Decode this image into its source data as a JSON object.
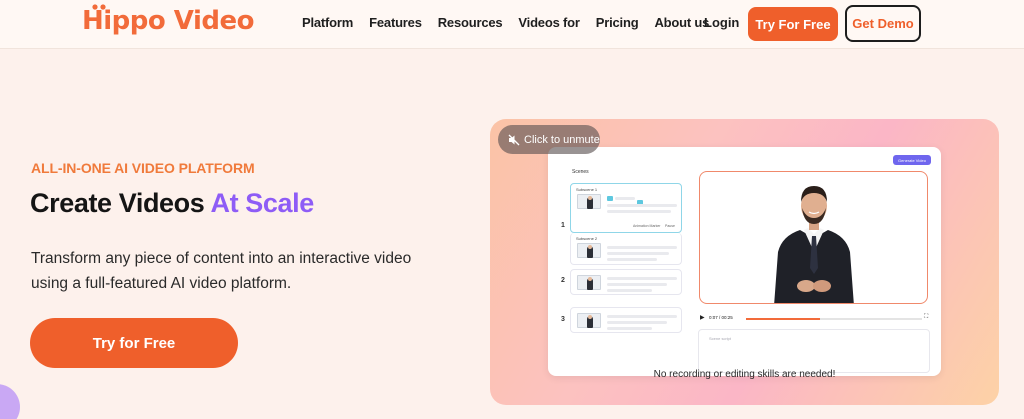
{
  "header": {
    "logo_text": "Hippo Video",
    "nav": [
      "Platform",
      "Features",
      "Resources",
      "Videos for",
      "Pricing",
      "About us"
    ],
    "login_label": "Login",
    "try_label": "Try For Free",
    "demo_label": "Get Demo"
  },
  "hero": {
    "eyebrow": "ALL-IN-ONE AI VIDEO PLATFORM",
    "headline_main": "Create Videos",
    "headline_accent": "At Scale",
    "description": "Transform any piece of content into an interactive video using a full-featured AI video platform.",
    "cta_label": "Try for Free"
  },
  "video_card": {
    "unmute_label": "Click to unmute",
    "generate_label": "Generate Video",
    "scenes_label": "Scenes",
    "subscenes": [
      "Subscene 1",
      "Subscene 2"
    ],
    "scene_numbers": [
      "1",
      "2",
      "3"
    ],
    "mini_actions": [
      "Animation Marker",
      "Pause"
    ],
    "time_current": "0:07",
    "time_total": "/ 00:25",
    "progress": 0.42,
    "script_placeholder": "Scene script",
    "caption": "No recording or editing skills are needed!"
  },
  "colors": {
    "brand_orange": "#ef5f2b",
    "accent_purple": "#8e5cf6",
    "eyebrow_orange": "#f07a3b"
  },
  "icons": {
    "unmute": "speaker-muted-icon",
    "play": "play-icon",
    "fullscreen": "fullscreen-icon"
  }
}
